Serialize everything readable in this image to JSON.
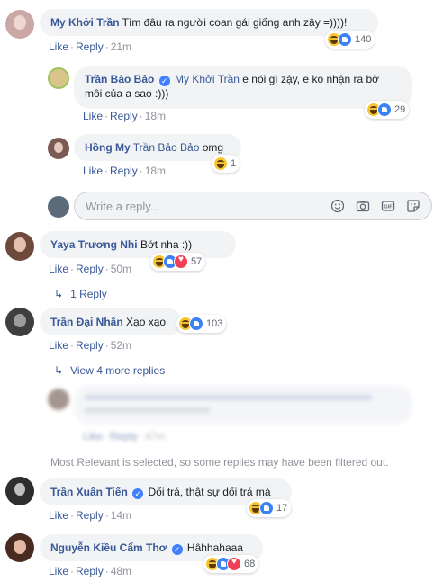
{
  "comments": [
    {
      "name": "My Khởi Trần",
      "text": "Tìm đâu ra người coan gái giống anh zậy =))))!",
      "actions": {
        "like": "Like",
        "reply": "Reply",
        "time": "21m"
      },
      "reaction_count": "140",
      "reactions": [
        "haha",
        "like"
      ],
      "avatar_color": "#c9a8a6"
    },
    {
      "name": "Trần Bảo Bảo",
      "mention": "My Khởi Trần",
      "text": "e nói gì zậy, e ko nhận ra bờ môi của a sao :)))",
      "line2": "môi của a sao :)))",
      "actions": {
        "like": "Like",
        "reply": "Reply",
        "time": "18m"
      },
      "reaction_count": "29",
      "reactions": [
        "haha",
        "like"
      ],
      "avatar_color": "#d9c48a"
    },
    {
      "name": "Hồng My",
      "mention": "Trần Bảo Bảo",
      "text": "omg",
      "actions": {
        "like": "Like",
        "reply": "Reply",
        "time": "18m"
      },
      "reaction_count": "1",
      "reactions": [
        "haha"
      ],
      "avatar_color": "#7a5a52"
    },
    {
      "name": "Yaya Trương Nhi",
      "text": "Bớt nha :))",
      "actions": {
        "like": "Like",
        "reply": "Reply",
        "time": "50m"
      },
      "reaction_count": "57",
      "reactions": [
        "haha",
        "like",
        "love"
      ],
      "avatar_color": "#6e4a3c",
      "replies_link": "1 Reply"
    },
    {
      "name": "Trần Đại Nhân",
      "text": "Xạo xạo",
      "actions": {
        "like": "Like",
        "reply": "Reply",
        "time": "52m"
      },
      "reaction_count": "103",
      "reactions": [
        "haha",
        "like"
      ],
      "avatar_color": "#3f3f3f",
      "replies_link": "View 4 more replies"
    },
    {
      "name": "Trần Xuân Tiến",
      "text": "Dối trá, thật sự dối trá mà",
      "actions": {
        "like": "Like",
        "reply": "Reply",
        "time": "14m"
      },
      "reaction_count": "17",
      "reactions": [
        "haha",
        "like"
      ],
      "avatar_color": "#2e2e2e"
    },
    {
      "name": "Nguyễn Kiều Cẩm Thơ",
      "text": "Hâhhahaaa",
      "actions": {
        "like": "Like",
        "reply": "Reply",
        "time": "48m"
      },
      "reaction_count": "68",
      "reactions": [
        "haha",
        "like",
        "love"
      ],
      "avatar_color": "#4a2b22"
    }
  ],
  "composer": {
    "placeholder": "Write a reply..."
  },
  "filter_note": "Most Relevant is selected, so some replies may have been filtered out.",
  "hidden_reply": {
    "actions": {
      "like": "Like",
      "reply": "Reply",
      "time": "47m"
    }
  },
  "colors": {
    "link": "#385898",
    "muted": "#90949c",
    "bubble": "#f2f3f5"
  }
}
